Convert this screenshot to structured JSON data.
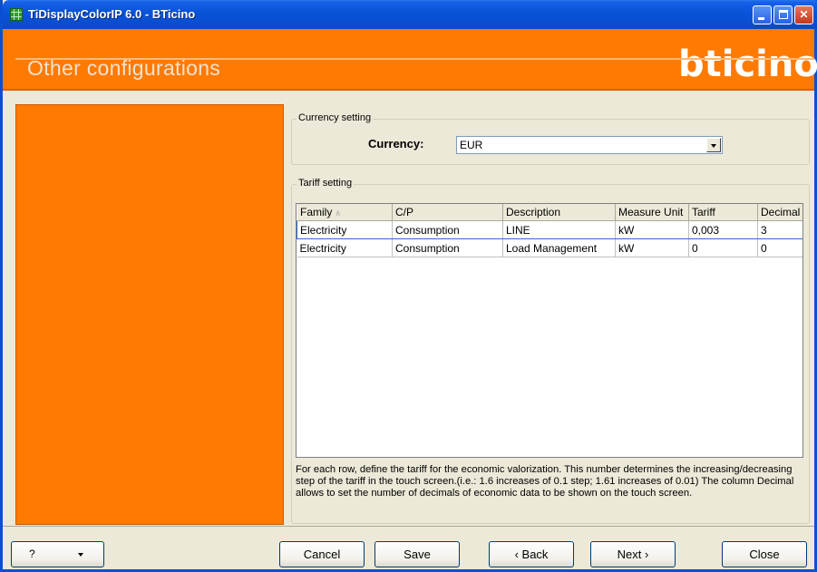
{
  "window": {
    "title": "TiDisplayColorIP 6.0 - BTicino"
  },
  "header": {
    "page_title": "Other configurations",
    "logo_text": "bticino",
    "accent_color": "#ff7a00"
  },
  "currency_group": {
    "label": "Currency setting",
    "currency_label": "Currency:",
    "currency_value": "EUR"
  },
  "tariff_group": {
    "label": "Tariff setting",
    "columns": [
      "Family",
      "C/P",
      "Description",
      "Measure Unit",
      "Tariff",
      "Decimal"
    ],
    "sorted_column": "Family",
    "rows": [
      [
        "Electricity",
        "Consumption",
        "LINE",
        "kW",
        "0,003",
        "3"
      ],
      [
        "Electricity",
        "Consumption",
        "Load Management",
        "kW",
        "0",
        "0"
      ]
    ],
    "selected_row": 0,
    "help_text": "For each row, define the tariff for the economic valorization. This number determines the increasing/decreasing step of the tariff in the touch screen.(i.e.: 1.6 increases of 0.1 step; 1.61 increases of 0.01) The column Decimal allows to set the number of decimals of economic data to be shown on the touch screen."
  },
  "buttons": {
    "help": "?",
    "cancel": "Cancel",
    "save": "Save",
    "back": "‹ Back",
    "next": "Next ›",
    "close": "Close"
  }
}
